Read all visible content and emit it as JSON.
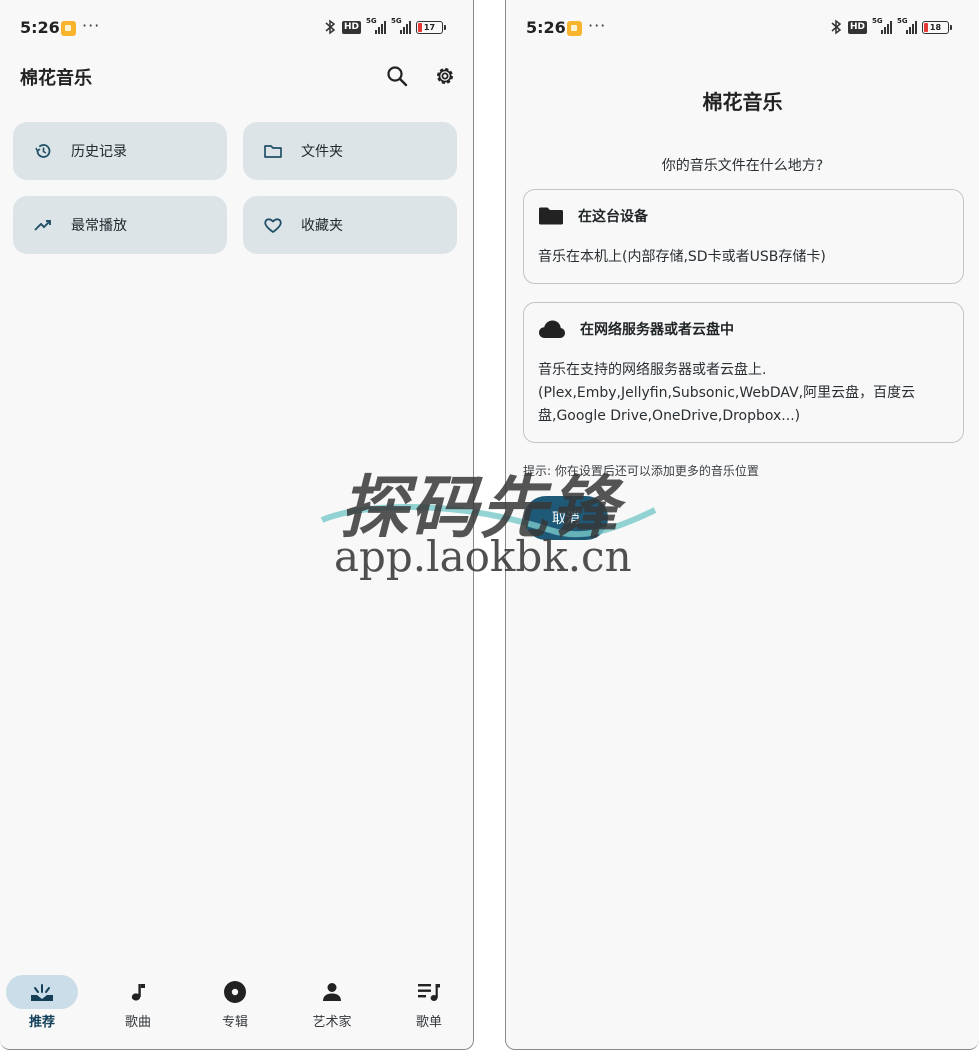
{
  "left_screen": {
    "status": {
      "time": "5:26",
      "more": "···",
      "hd": "HD",
      "net1": "5G",
      "net2": "5G",
      "battery": "17"
    },
    "header": {
      "title": "棉花音乐",
      "search_icon": "search-icon",
      "settings_icon": "gear-icon"
    },
    "tiles": [
      {
        "label": "历史记录",
        "icon": "history-icon"
      },
      {
        "label": "文件夹",
        "icon": "folder-icon"
      },
      {
        "label": "最常播放",
        "icon": "trending-icon"
      },
      {
        "label": "收藏夹",
        "icon": "heart-icon"
      }
    ],
    "nav": [
      {
        "label": "推荐",
        "icon": "for-you-icon",
        "active": true
      },
      {
        "label": "歌曲",
        "icon": "music-note-icon",
        "active": false
      },
      {
        "label": "专辑",
        "icon": "album-icon",
        "active": false
      },
      {
        "label": "艺术家",
        "icon": "artist-icon",
        "active": false
      },
      {
        "label": "歌单",
        "icon": "playlist-icon",
        "active": false
      }
    ]
  },
  "right_screen": {
    "status": {
      "time": "5:26",
      "more": "···",
      "hd": "HD",
      "net1": "5G",
      "net2": "5G",
      "battery": "18"
    },
    "title": "棉花音乐",
    "question": "你的音乐文件在什么地方?",
    "options": [
      {
        "title": "在这台设备",
        "icon": "folder-icon",
        "desc": "音乐在本机上(内部存储,SD卡或者USB存储卡)"
      },
      {
        "title": "在网络服务器或者云盘中",
        "icon": "cloud-icon",
        "desc": "音乐在支持的网络服务器或者云盘上.\n(Plex,Emby,Jellyfin,Subsonic,WebDAV,阿里云盘，百度云盘,Google Drive,OneDrive,Dropbox...)"
      }
    ],
    "hint": "提示: 你在设置后还可以添加更多的音乐位置",
    "cancel_label": "取消"
  },
  "watermark": {
    "main": "探码先锋",
    "sub": "app.laokbk.cn"
  },
  "colors": {
    "tile_bg": "#dde4e8",
    "accent": "#1e5a78",
    "nav_active_pill": "#cadde8",
    "battery_low": "#e53935"
  }
}
